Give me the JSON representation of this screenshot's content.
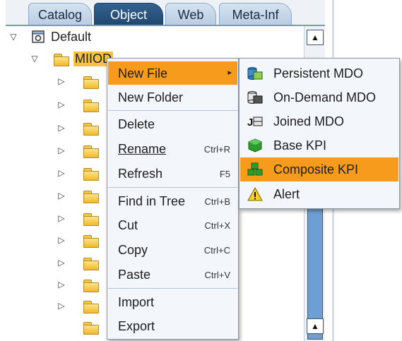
{
  "tabs": [
    {
      "label": "Catalog"
    },
    {
      "label": "Object"
    },
    {
      "label": "Web"
    },
    {
      "label": "Meta-Inf"
    }
  ],
  "tree": {
    "root_label": "Default",
    "selected_label": "MIIOD"
  },
  "context_menu": {
    "items": [
      {
        "label": "New File",
        "shortcut": "",
        "has_submenu": true
      },
      {
        "label": "New Folder",
        "shortcut": ""
      },
      {
        "label": "Delete",
        "shortcut": ""
      },
      {
        "label": "Rename",
        "shortcut": "Ctrl+R"
      },
      {
        "label": "Refresh",
        "shortcut": "F5"
      },
      {
        "label": "Find in Tree",
        "shortcut": "Ctrl+B"
      },
      {
        "label": "Cut",
        "shortcut": "Ctrl+X"
      },
      {
        "label": "Copy",
        "shortcut": "Ctrl+C"
      },
      {
        "label": "Paste",
        "shortcut": "Ctrl+V"
      },
      {
        "label": "Import",
        "shortcut": ""
      },
      {
        "label": "Export",
        "shortcut": ""
      }
    ],
    "submenu_arrow": "▸"
  },
  "submenu": {
    "items": [
      {
        "label": "Persistent MDO",
        "icon": "persistent-mdo-icon"
      },
      {
        "label": "On-Demand MDO",
        "icon": "on-demand-mdo-icon"
      },
      {
        "label": "Joined MDO",
        "icon": "joined-mdo-icon"
      },
      {
        "label": "Base KPI",
        "icon": "base-kpi-icon"
      },
      {
        "label": "Composite KPI",
        "icon": "composite-kpi-icon"
      },
      {
        "label": "Alert",
        "icon": "alert-icon"
      }
    ]
  },
  "colors": {
    "highlight": "#f79b1c",
    "active_tab": "#2b5480",
    "selection": "#f8c23c"
  }
}
